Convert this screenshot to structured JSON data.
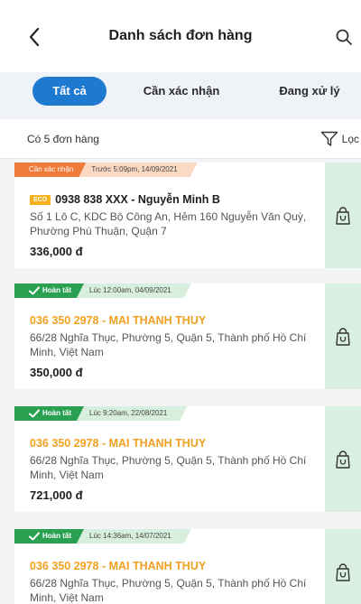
{
  "header": {
    "title": "Danh sách đơn hàng",
    "back_icon": "chevron-left-icon",
    "search_icon": "search-icon"
  },
  "tabs": [
    {
      "label": "Tất cả",
      "active": true
    },
    {
      "label": "Cần xác nhận",
      "active": false
    },
    {
      "label": "Đang xử lý",
      "active": false
    }
  ],
  "summary": {
    "count_text": "Có 5 đơn hàng",
    "filter_label": "Lọc",
    "filter_icon": "funnel-icon"
  },
  "colors": {
    "primary": "#1e7ad0",
    "pending": "#f07a3a",
    "done": "#2aa150",
    "highlight_text": "#f0a020",
    "action_bg": "#d8efe1"
  },
  "orders": [
    {
      "status": "Cần xác nhận",
      "status_type": "pending",
      "time": "Trước 5:09pm, 14/09/2021",
      "tag": "ECO",
      "title": "0938 838 XXX - Nguyễn Minh B",
      "address": "Số 1 Lô C, KDC Bộ Công An, Hẻm 160 Nguyễn Văn Quỳ, Phường Phú Thuận, Quận 7",
      "amount": "336,000 đ"
    },
    {
      "status": "Hoàn tất",
      "status_type": "done",
      "time": "Lúc 12:00am, 04/09/2021",
      "title": "036 350 2978 - MAI THANH THUY",
      "address": "66/28 Nghĩa Thục, Phường 5, Quận 5, Thành phố Hồ Chí Minh, Việt Nam",
      "amount": "350,000 đ"
    },
    {
      "status": "Hoàn tất",
      "status_type": "done",
      "time": "Lúc 9:20am, 22/08/2021",
      "title": "036 350 2978 - MAI THANH THUY",
      "address": "66/28 Nghĩa Thục, Phường 5, Quận 5, Thành phố Hồ Chí Minh, Việt Nam",
      "amount": "721,000 đ"
    },
    {
      "status": "Hoàn tất",
      "status_type": "done",
      "time": "Lúc 14:36am, 14/07/2021",
      "title": "036 350 2978 - MAI THANH THUY",
      "address": "66/28 Nghĩa Thục, Phường 5, Quận 5, Thành phố Hồ Chí Minh, Việt Nam",
      "amount": ""
    }
  ]
}
